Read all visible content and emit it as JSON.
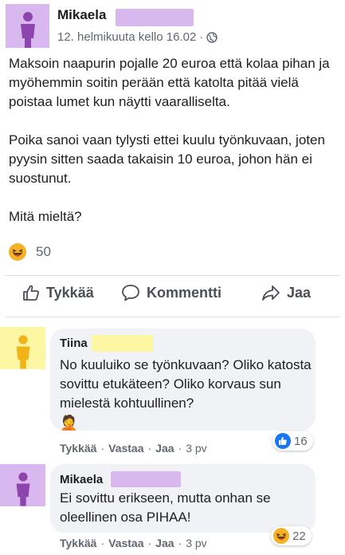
{
  "post": {
    "author": "Mikaela",
    "timestamp": "12. helmikuuta kello 16.02",
    "separator": "·",
    "paragraphs": [
      "Maksoin naapurin pojalle 20 euroa että kolaa pihan ja myöhemmin soitin perään että katolta pitää vielä poistaa lumet kun näytti vaaralliselta.",
      "Poika sanoi vaan tylysti ettei kuulu työnkuvaan, joten pyysin sitten saada takaisin 10 euroa, johon hän ei suostunut.",
      "Mitä mieltä?"
    ],
    "reaction_count": "50",
    "reaction_icon": "laugh-emoji"
  },
  "actions": {
    "like": "Tykkää",
    "comment": "Kommentti",
    "share": "Jaa"
  },
  "comments": [
    {
      "author": "Tiina",
      "text": "No kuuluiko se työnkuvaan? Oliko katosta sovittu etukäteen? Oliko korvaus sun mielestä kohtuullinen?",
      "emoji": "🤦",
      "like": "Tykkää",
      "reply": "Vastaa",
      "share": "Jaa",
      "age": "3 pv",
      "sep": "·",
      "reaction_count": "16",
      "reaction_icon": "like-icon",
      "avatar_color": "#fdf6a3"
    },
    {
      "author": "Mikaela",
      "text": "Ei sovittu erikseen, mutta onhan se oleellinen osa PIHAA!",
      "like": "Tykkää",
      "reply": "Vastaa",
      "share": "Jaa",
      "age": "3 pv",
      "sep": "·",
      "reaction_count": "22",
      "reaction_icon": "laugh-emoji",
      "avatar_color": "#d9b8f0"
    }
  ],
  "colors": {
    "name_highlight_purple": "#d9b8f0",
    "name_highlight_yellow": "#fdf6a3",
    "avatar_figure_purple": "#9b59b6",
    "avatar_figure_yellow": "#f0c419"
  }
}
